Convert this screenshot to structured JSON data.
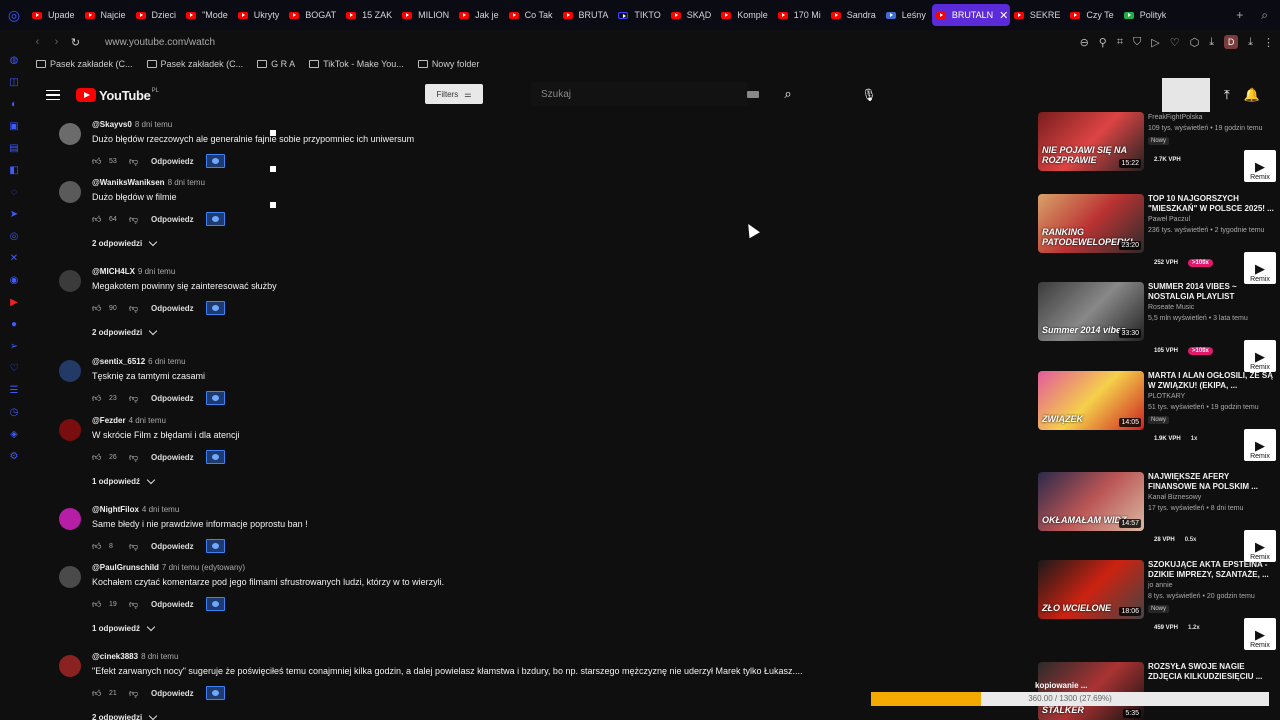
{
  "browser": {
    "tabs": [
      {
        "label": "Upade",
        "icon": "youtube-icon"
      },
      {
        "label": "Najcie",
        "icon": "youtube-icon"
      },
      {
        "label": "Dzieci",
        "icon": "youtube-icon"
      },
      {
        "label": "\"Mode",
        "icon": "youtube-icon"
      },
      {
        "label": "Ukryty",
        "icon": "youtube-icon"
      },
      {
        "label": "BOGAT",
        "icon": "youtube-icon"
      },
      {
        "label": "15 ZAK",
        "icon": "youtube-icon"
      },
      {
        "label": "MILION",
        "icon": "youtube-icon"
      },
      {
        "label": "Jak je",
        "icon": "youtube-icon"
      },
      {
        "label": "Co Tak",
        "icon": "youtube-icon"
      },
      {
        "label": "BRUTA",
        "icon": "youtube-icon"
      },
      {
        "label": "TIKTO",
        "icon": "tiktok-icon"
      },
      {
        "label": "SKĄD",
        "icon": "youtube-icon"
      },
      {
        "label": "Komple",
        "icon": "youtube-icon"
      },
      {
        "label": "170 Mi",
        "icon": "youtube-icon"
      },
      {
        "label": "Sandra",
        "icon": "youtube-icon"
      },
      {
        "label": "Leśny",
        "icon": "document-icon"
      },
      {
        "label": "BRUTALN",
        "icon": "youtube-icon",
        "active": true
      },
      {
        "label": "SEKRE",
        "icon": "youtube-icon"
      },
      {
        "label": "Czy Te",
        "icon": "youtube-icon"
      },
      {
        "label": "Polityk",
        "icon": "feedly-icon"
      }
    ],
    "url": "www.youtube.com/watch",
    "profile_letter": "D",
    "bookmarks": [
      {
        "label": "Pasek zakładek (C..."
      },
      {
        "label": "Pasek zakładek (C..."
      },
      {
        "label": "G R A"
      },
      {
        "label": "TikTok - Make You..."
      },
      {
        "label": "Nowy folder"
      }
    ]
  },
  "header": {
    "logo_text": "YouTube",
    "logo_region": "PL",
    "filters_label": "Filters",
    "search_placeholder": "Szukaj"
  },
  "comments": [
    {
      "author": "@Skayvs0",
      "time": "8 dni temu",
      "text": "Dużo błędów rzeczowych ale generalnie fajnie sobie przypomniec ich uniwersum",
      "likes": "53",
      "reply_label": "Odpowiedz",
      "replies": null
    },
    {
      "author": "@WaniksWaniksen",
      "time": "8 dni temu",
      "text": "Dużo błędów w filmie",
      "likes": "64",
      "reply_label": "Odpowiedz",
      "replies": "2 odpowiedzi"
    },
    {
      "author": "@MICH4LX",
      "time": "9 dni temu",
      "text": "Megakotem powinny się zainteresować służby",
      "likes": "90",
      "reply_label": "Odpowiedz",
      "replies": "2 odpowiedzi"
    },
    {
      "author": "@sentix_6512",
      "time": "6 dni temu",
      "text": "Tęsknię za tamtymi czasami",
      "likes": "23",
      "reply_label": "Odpowiedz",
      "replies": null
    },
    {
      "author": "@Fezder",
      "time": "4 dni temu",
      "text": "W skrócie Film z błędami i dla atencji",
      "likes": "26",
      "reply_label": "Odpowiedz",
      "replies": "1 odpowiedź"
    },
    {
      "author": "@NightFilox",
      "time": "4 dni temu",
      "text": "Same błedy i nie prawdziwe informacje poprostu ban !",
      "likes": "8",
      "reply_label": "Odpowiedz",
      "replies": null
    },
    {
      "author": "@PaulGrunschild",
      "time": "7 dni temu (edytowany)",
      "text": "Kochałem czytać komentarze pod jego filmami sfrustrowanych ludzi, którzy w to wierzyli.",
      "likes": "19",
      "reply_label": "Odpowiedz",
      "replies": "1 odpowiedź"
    },
    {
      "author": "@cinek3883",
      "time": "8 dni temu",
      "text": "\"Efekt zarwanych nocy\" sugeruje że poświęciłeś temu conajmniej kilka godzin, a dalej powielasz kłamstwa i bzdury, bo np. starszego mężczyznę nie uderzył Marek tylko Łukasz....",
      "likes": "21",
      "reply_label": "Odpowiedz",
      "replies": "2 odpowiedzi"
    }
  ],
  "videos": [
    {
      "title": "",
      "thumb_text": "NIE POJAWI SIĘ NA ROZPRAWIE",
      "duration": "15:22",
      "channel": "FreakFightPolska",
      "meta": "109 tys. wyświetleń • 19 godzin temu",
      "badge": "Nowy",
      "vph": "2.7K VPH",
      "ratio": "",
      "remix": "Remix"
    },
    {
      "title": "TOP 10 NAJGORSZYCH \"MIESZKAŃ\" W POLSCE 2025! ...",
      "thumb_text": "RANKING PATODEWELOPERKI",
      "duration": "23:20",
      "channel": "Paweł Paczul",
      "meta": "236 tys. wyświetleń • 2 tygodnie temu",
      "badge": "",
      "vph": "252 VPH",
      "ratio": ">100x",
      "remix": "Remix"
    },
    {
      "title": "summer 2014 vibes ~ nostalgia playlist",
      "thumb_text": "Summer 2014 vibes",
      "duration": "33:30",
      "channel": "Roseate Music",
      "meta": "5,5 mln wyświetleń • 3 lata temu",
      "badge": "",
      "vph": "105 VPH",
      "ratio": ">100x",
      "remix": "Remix"
    },
    {
      "title": "MARTA I ALAN OGŁOSILI, ŻE SĄ W ZWIĄZKU! (EKIPA, ...",
      "thumb_text": "ZWIĄZEK",
      "duration": "14:05",
      "channel": "PLOTKARY",
      "meta": "51 tys. wyświetleń • 19 godzin temu",
      "badge": "Nowy",
      "vph": "1.9K VPH",
      "ratio": "1x",
      "remix": "Remix"
    },
    {
      "title": "NAJWIĘKSZE AFERY FINANSOWE NA POLSKIM ...",
      "thumb_text": "OKŁAMAŁAM WIDZ",
      "duration": "14:57",
      "channel": "Kanał Biznesowy",
      "meta": "17 tys. wyświetleń • 8 dni temu",
      "badge": "",
      "vph": "28 VPH",
      "ratio": "0.5x",
      "remix": "Remix"
    },
    {
      "title": "SZOKUJĄCE AKTA EPSTEINA - DZIKIE IMPREZY, SZANTAŻE, ...",
      "thumb_text": "ZŁO WCIELONE",
      "duration": "18:06",
      "channel": "jo annie",
      "meta": "8 tys. wyświetleń • 20 godzin temu",
      "badge": "Nowy",
      "vph": "459 VPH",
      "ratio": "1.2x",
      "remix": "Remix"
    },
    {
      "title": "ROZSYŁA SWOJE NAGIE ZDJĘCIA KILKUDZIESIĘCIU ...",
      "thumb_text": "STALKER",
      "duration": "5:35",
      "channel": "",
      "meta": "",
      "badge": "",
      "vph": "",
      "ratio": "",
      "remix": ""
    }
  ],
  "download": {
    "label": "kopiowanie ...",
    "progress_text": "360.00 / 1300 (27.69%)",
    "progress_fraction": 0.2769
  },
  "colors": {
    "accent_red": "#ff0000",
    "active_tab": "#5b2bd9",
    "vph_pill": "#e0196c",
    "progress_fill": "#f2a900"
  }
}
